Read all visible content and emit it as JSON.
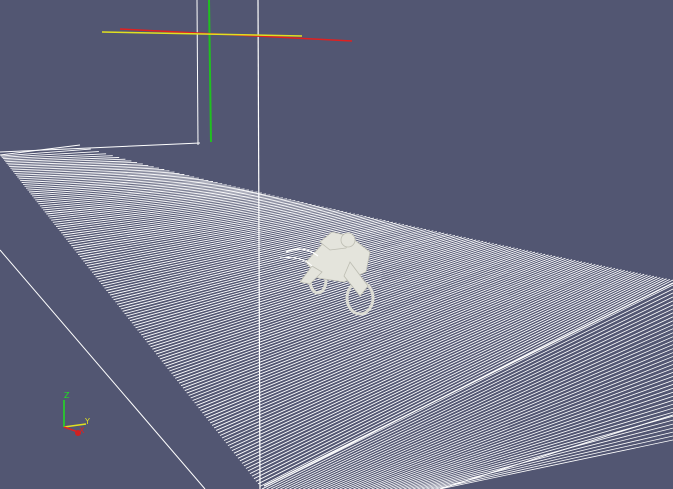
{
  "viewport": {
    "background_color": "#525672",
    "foreground_color": "#ffffff",
    "mesh_color": "#ffffff",
    "model_color": "#e4e4dc"
  },
  "scene_objects": {
    "streamline_surface": "streamline-slice-mesh",
    "model": "motorbike-model",
    "probe_line": "vertical-probe-line"
  },
  "widgets": {
    "plane_axes": {
      "x_color": "#e02020",
      "y_color": "#e0e020",
      "z_color": "#20c020"
    }
  },
  "orientation_axes": {
    "z_label": "Z",
    "y_label": "Y",
    "x_label": "X",
    "z_color": "#20e020",
    "y_color": "#e0e020",
    "x_color": "#e02020"
  }
}
